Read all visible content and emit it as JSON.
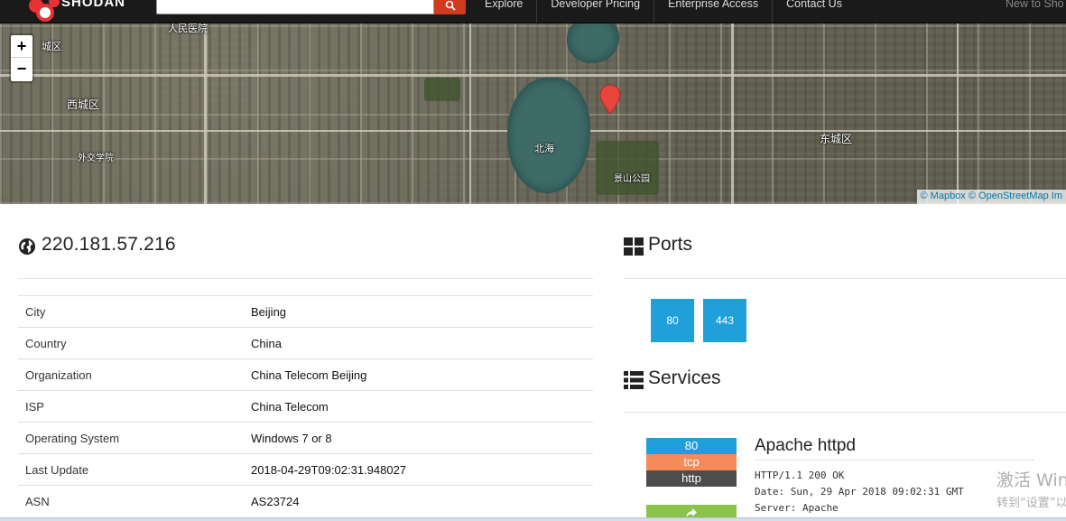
{
  "topbar": {
    "logo_text": "SHODAN",
    "search": {
      "value": "",
      "placeholder": ""
    },
    "nav": [
      "Explore",
      "Developer Pricing",
      "Enterprise Access",
      "Contact Us"
    ],
    "nav_right": "New to Sho"
  },
  "map": {
    "zoom_in": "+",
    "zoom_out": "−",
    "labels": {
      "top_left": "人民医院",
      "area_top_left": "城区",
      "xicheng": "西城区",
      "beihai": "北海",
      "dongcheng": "东城区",
      "jingshan": "景山公园",
      "waijiao": "外交学院"
    },
    "attribution": {
      "mapbox": "© Mapbox",
      "osm": "© OpenStreetMap",
      "more": "Im"
    }
  },
  "host": {
    "ip": "220.181.57.216",
    "details": [
      {
        "key": "City",
        "value": "Beijing"
      },
      {
        "key": "Country",
        "value": "China"
      },
      {
        "key": "Organization",
        "value": "China Telecom Beijing"
      },
      {
        "key": "ISP",
        "value": "China Telecom"
      },
      {
        "key": "Operating System",
        "value": "Windows 7 or 8"
      },
      {
        "key": "Last Update",
        "value": "2018-04-29T09:02:31.948027"
      },
      {
        "key": "ASN",
        "value": "AS23724"
      }
    ]
  },
  "ports": {
    "title": "Ports",
    "list": [
      "80",
      "443"
    ]
  },
  "services": {
    "title": "Services",
    "items": [
      {
        "port": "80",
        "protocol": "tcp",
        "name": "http",
        "product": "Apache httpd",
        "banner": [
          "HTTP/1.1 200 OK",
          "Date: Sun, 29 Apr 2018 09:02:31 GMT",
          "Server: Apache"
        ]
      }
    ]
  },
  "watermark": {
    "line1": "激活 Win",
    "line2": "转到“设置”以"
  },
  "colors": {
    "topbar": "#1a1a1a",
    "search_button": "#d03a1e",
    "port_blue": "#1fa0d8",
    "protocol_orange": "#f58a5b",
    "service_dark": "#4d4d4d",
    "link_green": "#8bc34a",
    "marker_red": "#e8443b"
  }
}
